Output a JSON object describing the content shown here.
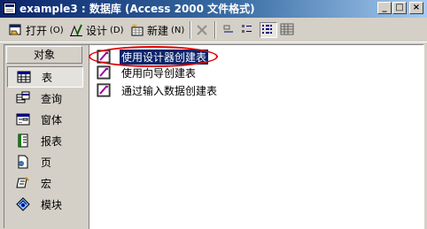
{
  "window": {
    "title": "example3 : 数据库 (Access 2000 文件格式)"
  },
  "window_buttons": {
    "minimize": "_",
    "maximize": "□",
    "close": "×"
  },
  "toolbar": {
    "open_label": "打开",
    "open_key": "(O)",
    "design_label": "设计",
    "design_key": "(D)",
    "new_label": "新建",
    "new_key": "(N)"
  },
  "sidebar": {
    "header": "对象",
    "items": [
      {
        "label": "表",
        "icon": "table-icon",
        "selected": true
      },
      {
        "label": "查询",
        "icon": "query-icon",
        "selected": false
      },
      {
        "label": "窗体",
        "icon": "form-icon",
        "selected": false
      },
      {
        "label": "报表",
        "icon": "report-icon",
        "selected": false
      },
      {
        "label": "页",
        "icon": "page-icon",
        "selected": false
      },
      {
        "label": "宏",
        "icon": "macro-icon",
        "selected": false
      },
      {
        "label": "模块",
        "icon": "module-icon",
        "selected": false
      }
    ]
  },
  "list": {
    "items": [
      {
        "label": "使用设计器创建表",
        "selected": true
      },
      {
        "label": "使用向导创建表",
        "selected": false
      },
      {
        "label": "通过输入数据创建表",
        "selected": false
      }
    ]
  },
  "colors": {
    "title_start": "#0a246a",
    "title_end": "#a6caf0",
    "selection": "#0a246a",
    "highlight": "#e00000"
  }
}
